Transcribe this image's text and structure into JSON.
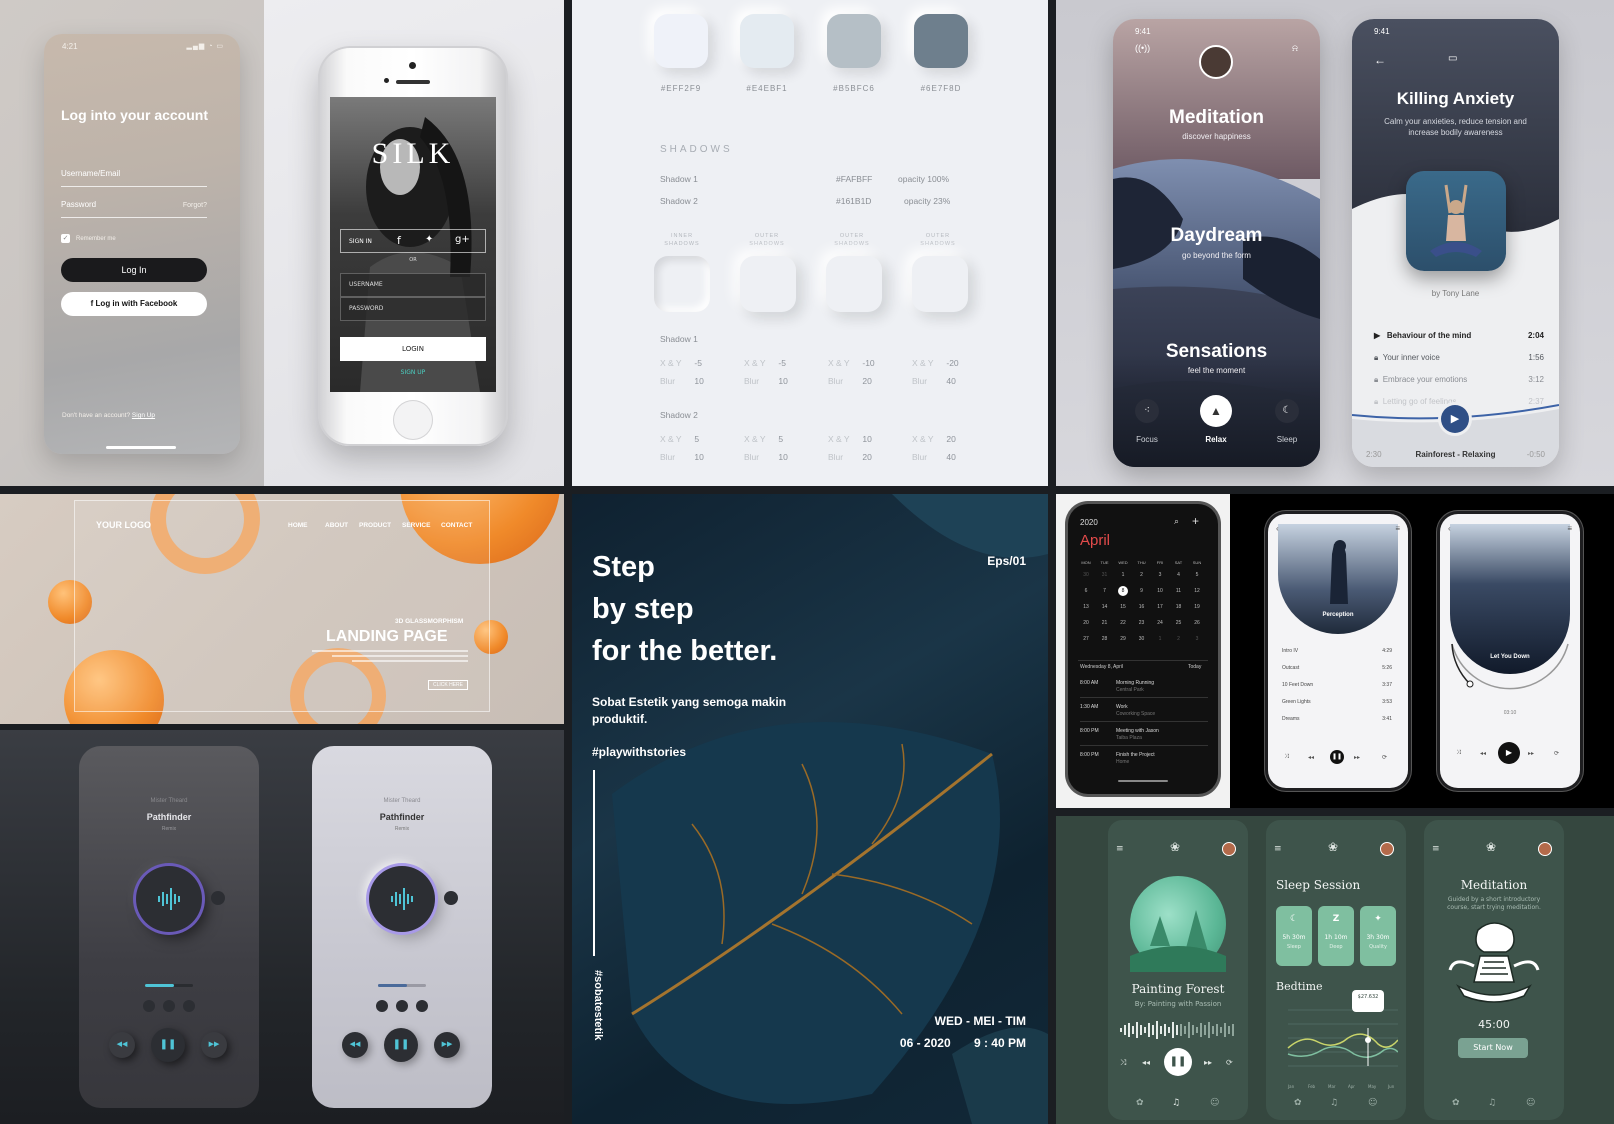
{
  "login_card": {
    "time": "4:21",
    "title": "Log into your account",
    "username_placeholder": "Username/Email",
    "password_placeholder": "Password",
    "forgot_label": "Forgot?",
    "remember_label": "Remember me",
    "login_button": "Log In",
    "facebook_button": "Log in with Facebook",
    "signup_prompt": "Don't have an account?",
    "signup_link": "Sign Up"
  },
  "silk_app": {
    "brand": "SILK",
    "sign_in_label": "SIGN IN",
    "or_label": "OR",
    "username_placeholder": "USERNAME",
    "password_placeholder": "PASSWORD",
    "login_button": "LOGIN",
    "signup_link": "SIGN UP"
  },
  "style_guide": {
    "swatches": [
      {
        "hex": "#EFF2F9",
        "label": "#EFF2F9"
      },
      {
        "hex": "#E4EBF1",
        "label": "#E4EBF1"
      },
      {
        "hex": "#B5BFC6",
        "label": "#B5BFC6"
      },
      {
        "hex": "#6E7F8D",
        "label": "#6E7F8D"
      }
    ],
    "shadows_title": "SHADOWS",
    "shadow_rows": [
      {
        "name": "Shadow 1",
        "color": "#FAFBFF",
        "opacity": "opacity 100%"
      },
      {
        "name": "Shadow 2",
        "color": "#161B1D",
        "opacity": "opacity 23%"
      }
    ],
    "box_labels": [
      "INNER SHADOWS",
      "OUTER SHADOWS",
      "OUTER SHADOWS",
      "OUTER SHADOWS"
    ],
    "shadow1_title": "Shadow 1",
    "shadow1_values": [
      {
        "xy": "-5",
        "blur": "10"
      },
      {
        "xy": "-5",
        "blur": "10"
      },
      {
        "xy": "-10",
        "blur": "20"
      },
      {
        "xy": "-20",
        "blur": "40"
      }
    ],
    "shadow2_title": "Shadow 2",
    "shadow2_values": [
      {
        "xy": "5",
        "blur": "10"
      },
      {
        "xy": "5",
        "blur": "10"
      },
      {
        "xy": "10",
        "blur": "20"
      },
      {
        "xy": "20",
        "blur": "40"
      }
    ],
    "xy_label": "X & Y",
    "blur_label": "Blur"
  },
  "meditation_app": {
    "time": "9:41",
    "sections": [
      {
        "title": "Meditation",
        "subtitle": "discover happiness"
      },
      {
        "title": "Daydream",
        "subtitle": "go beyond the form"
      },
      {
        "title": "Sensations",
        "subtitle": "feel the moment"
      }
    ],
    "tabs": [
      "Focus",
      "Relax",
      "Sleep"
    ]
  },
  "anxiety_app": {
    "time": "9:41",
    "title": "Killing Anxiety",
    "description": "Calm your anxieties, reduce tension and increase bodily awareness",
    "author": "by Tony Lane",
    "tracks": [
      {
        "name": "Behaviour of the mind",
        "duration": "2:04"
      },
      {
        "name": "Your inner voice",
        "duration": "1:56"
      },
      {
        "name": "Embrace your emotions",
        "duration": "3:12"
      },
      {
        "name": "Letting go of feelings",
        "duration": "2:37"
      }
    ],
    "elapsed": "2:30",
    "now_playing": "Rainforest - Relaxing",
    "remaining": "-0:50"
  },
  "landing_page": {
    "logo": "YOUR LOGO",
    "nav": [
      "HOME",
      "ABOUT",
      "PRODUCT",
      "SERVICE",
      "CONTACT"
    ],
    "kicker": "3D GLASSMORPHISM",
    "title": "LANDING PAGE",
    "cta": "CLICK HERE"
  },
  "pathfinder": {
    "artist": "Mister Theard",
    "title": "Pathfinder",
    "subtitle": "Remix"
  },
  "story": {
    "headline_1": "Step",
    "headline_2": "by step",
    "headline_3": "for the better.",
    "subtitle": "Sobat Estetik yang semoga makin produktif.",
    "hashtag": "#playwithstories",
    "vertical_tag": "#sobatestetik",
    "episode": "Eps/01",
    "date_line": "WED  -  MEI  -  TIM",
    "time_line": "06 - 2020       9 : 40 PM"
  },
  "calendar_app": {
    "year": "2020",
    "month": "April",
    "weekdays": [
      "MON",
      "TUE",
      "WED",
      "THU",
      "FRI",
      "SAT",
      "SUN"
    ],
    "days": [
      "30",
      "31",
      "1",
      "2",
      "3",
      "4",
      "5",
      "6",
      "7",
      "8",
      "9",
      "10",
      "11",
      "12",
      "13",
      "14",
      "15",
      "16",
      "17",
      "18",
      "19",
      "20",
      "21",
      "22",
      "23",
      "24",
      "25",
      "26",
      "27",
      "28",
      "29",
      "30",
      "1",
      "2",
      "3"
    ],
    "selected_day": "8",
    "agenda_date": "Wednesday 8, April",
    "agenda_today": "Today",
    "events": [
      {
        "time": "8:00 AM",
        "title": "Morning Running",
        "place": "Central Park"
      },
      {
        "time": "1:30 AM",
        "title": "Work",
        "place": "Coworking Space"
      },
      {
        "time": "8:00 PM",
        "title": "Meeting with Jason",
        "place": "Taiba Plaza"
      },
      {
        "time": "8:00 PM",
        "title": "Finish the Project",
        "place": "Home"
      }
    ]
  },
  "music_app": {
    "perception_title": "Perception",
    "perception_tracks": [
      {
        "name": "Intro IV",
        "duration": "4:29"
      },
      {
        "name": "Outcast",
        "duration": "5:26"
      },
      {
        "name": "10 Feet Down",
        "duration": "3:37"
      },
      {
        "name": "Green Lights",
        "duration": "3:53"
      },
      {
        "name": "Dreams",
        "duration": "3:41"
      }
    ],
    "nowplaying_title": "Let You Down",
    "nowplaying_elapsed": "03:10"
  },
  "sleep_app": {
    "forest_title": "Painting Forest",
    "forest_sub": "By: Painting with Passion",
    "session_title": "Sleep Session",
    "cards": [
      {
        "icon": "moon",
        "value": "5h 30m",
        "label": "Sleep"
      },
      {
        "icon": "z",
        "value": "1h 10m",
        "label": "Deep"
      },
      {
        "icon": "star",
        "value": "3h 30m",
        "label": "Quality"
      }
    ],
    "bedtime_title": "Bedtime",
    "tooltip": "$27.632",
    "chart_months": [
      "Jan",
      "Feb",
      "Mar",
      "Apr",
      "May",
      "Jun"
    ],
    "meditation_title": "Meditation",
    "meditation_desc": "Guided by a short introductory course, start trying meditation.",
    "timer": "45:00",
    "start_button": "Start Now"
  }
}
